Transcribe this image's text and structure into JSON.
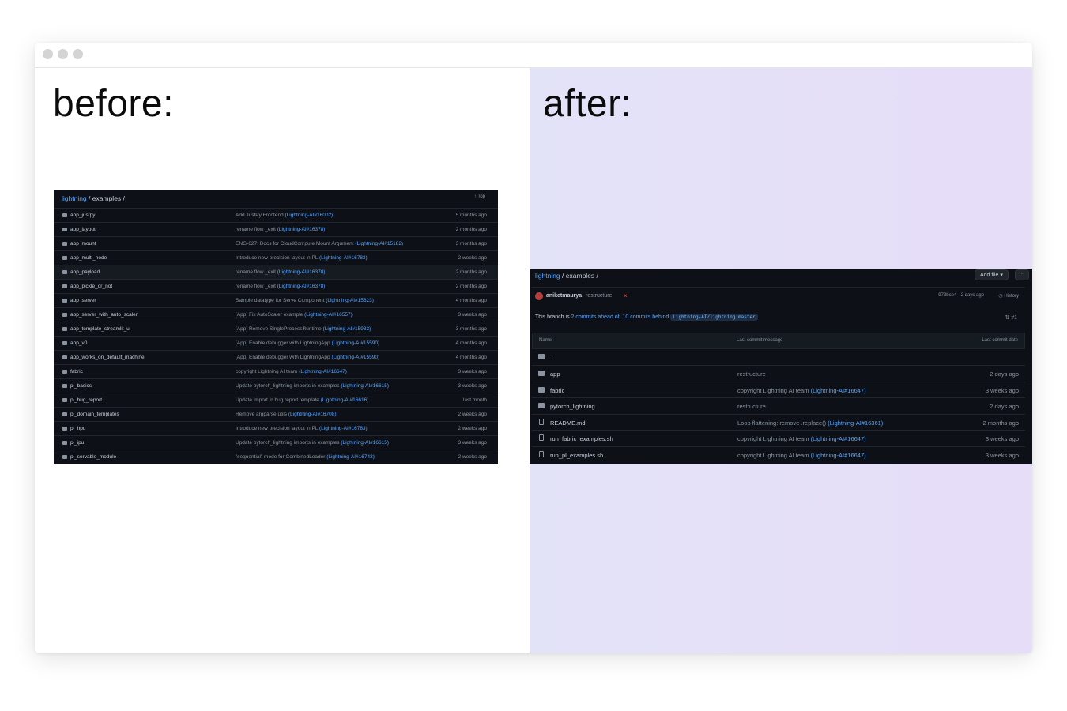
{
  "before_label": "before:",
  "after_label": "after:",
  "before": {
    "crumb_repo": "lightning",
    "crumb_sep": "/",
    "crumb_dir": "examples /",
    "top_label": "Top",
    "rows": [
      {
        "name": "app_justpy",
        "msg": "Add JustPy Frontend",
        "link": "(Lightning-AI#16002)",
        "ago": "5 months ago"
      },
      {
        "name": "app_layout",
        "msg": "rename flow _exit",
        "link": "(Lightning-AI#16378)",
        "ago": "2 months ago"
      },
      {
        "name": "app_mount",
        "msg": "ENG-627: Docs for CloudCompute Mount Argument",
        "link": "(Lightning-AI#15182)",
        "ago": "3 months ago"
      },
      {
        "name": "app_multi_node",
        "msg": "Introduce new precision layout in PL",
        "link": "(Lightning-AI#16783)",
        "ago": "2 weeks ago"
      },
      {
        "name": "app_payload",
        "msg": "rename flow _exit",
        "link": "(Lightning-AI#16378)",
        "ago": "2 months ago"
      },
      {
        "name": "app_pickle_or_not",
        "msg": "rename flow _exit",
        "link": "(Lightning-AI#16378)",
        "ago": "2 months ago"
      },
      {
        "name": "app_server",
        "msg": "Sample datatype for Serve Component",
        "link": "(Lightning-AI#15623)",
        "ago": "4 months ago"
      },
      {
        "name": "app_server_with_auto_scaler",
        "msg": "[App] Fix AutoScaler example",
        "link": "(Lightning-AI#16557)",
        "ago": "3 weeks ago"
      },
      {
        "name": "app_template_streamlit_ui",
        "msg": "[App] Remove SingleProcessRuntime",
        "link": "(Lightning-AI#15933)",
        "ago": "3 months ago"
      },
      {
        "name": "app_v0",
        "msg": "[App] Enable debugger with LightningApp",
        "link": "(Lightning-AI#15590)",
        "ago": "4 months ago"
      },
      {
        "name": "app_works_on_default_machine",
        "msg": "[App] Enable debugger with LightningApp",
        "link": "(Lightning-AI#15590)",
        "ago": "4 months ago"
      },
      {
        "name": "fabric",
        "msg": "copyright Lightning AI team",
        "link": "(Lightning-AI#16647)",
        "ago": "3 weeks ago"
      },
      {
        "name": "pl_basics",
        "msg": "Update pytorch_lightning imports in examples",
        "link": "(Lightning-AI#16615)",
        "ago": "3 weeks ago"
      },
      {
        "name": "pl_bug_report",
        "msg": "Update import in bug report template",
        "link": "(Lightning-AI#16616)",
        "ago": "last month"
      },
      {
        "name": "pl_domain_templates",
        "msg": "Remove argparse utils",
        "link": "(Lightning-AI#16708)",
        "ago": "2 weeks ago"
      },
      {
        "name": "pl_hpu",
        "msg": "Introduce new precision layout in PL",
        "link": "(Lightning-AI#16783)",
        "ago": "2 weeks ago"
      },
      {
        "name": "pl_ipu",
        "msg": "Update pytorch_lightning imports in examples",
        "link": "(Lightning-AI#16615)",
        "ago": "3 weeks ago"
      },
      {
        "name": "pl_servable_module",
        "msg": "\"sequential\" mode for CombinedLoader",
        "link": "(Lightning-AI#16743)",
        "ago": "2 weeks ago"
      }
    ]
  },
  "after": {
    "crumb_repo": "lightning",
    "crumb_sep": "/",
    "crumb_dir": "examples /",
    "add_file": "Add file",
    "more": "···",
    "commit_user": "aniketmaurya",
    "commit_msg": "restructure",
    "commit_status": "×",
    "commit_meta": "973bce4 · 2 days ago",
    "history": "History",
    "branch_pre": "This branch is",
    "branch_ahead": "2 commits ahead of",
    "branch_mid": ",",
    "branch_behind": "10 commits behind",
    "branch_ref": "Lightning-AI/lightning:master",
    "branch_end": ".",
    "pr_count": "#1",
    "col_name": "Name",
    "col_msg": "Last commit message",
    "col_date": "Last commit date",
    "parent": "..",
    "rows": [
      {
        "type": "dir",
        "name": "app",
        "msg": "restructure",
        "link": "",
        "ago": "2 days ago"
      },
      {
        "type": "dir",
        "name": "fabric",
        "msg": "copyright Lightning AI team",
        "link": "(Lightning-AI#16647)",
        "ago": "3 weeks ago"
      },
      {
        "type": "dir",
        "name": "pytorch_lightning",
        "msg": "restructure",
        "link": "",
        "ago": "2 days ago"
      },
      {
        "type": "file",
        "name": "README.md",
        "msg": "Loop flattening: remove .replace()",
        "link": "(Lightning-AI#16361)",
        "ago": "2 months ago"
      },
      {
        "type": "file",
        "name": "run_fabric_examples.sh",
        "msg": "copyright Lightning AI team",
        "link": "(Lightning-AI#16647)",
        "ago": "3 weeks ago"
      },
      {
        "type": "file",
        "name": "run_pl_examples.sh",
        "msg": "copyright Lightning AI team",
        "link": "(Lightning-AI#16647)",
        "ago": "3 weeks ago"
      }
    ]
  }
}
